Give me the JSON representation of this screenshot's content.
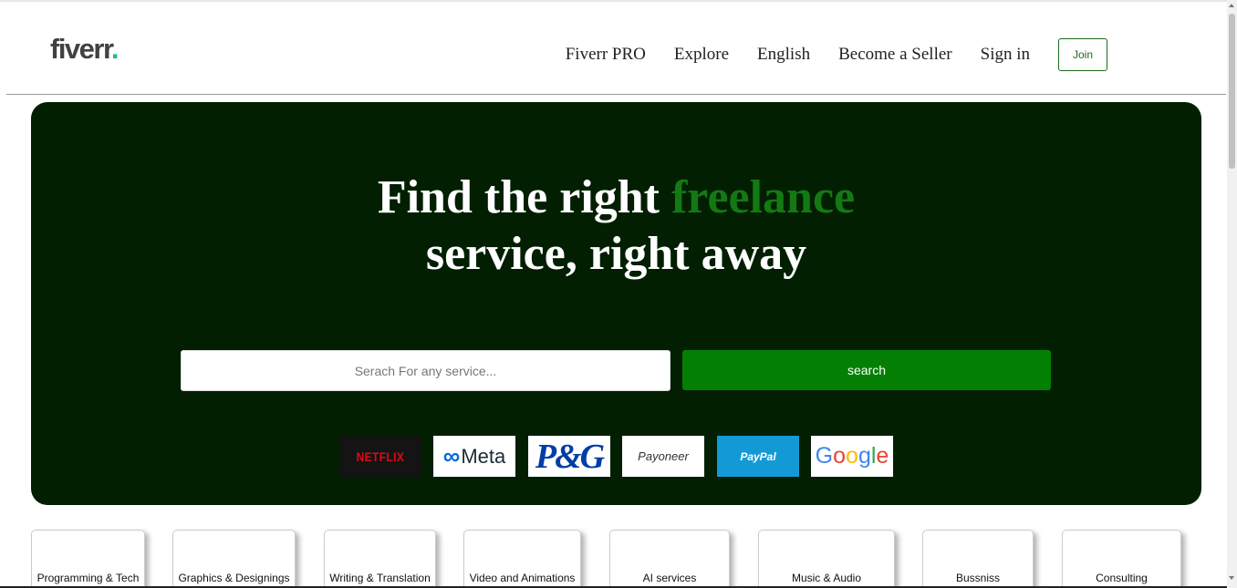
{
  "header": {
    "logo_text": "fiverr",
    "logo_dot": ".",
    "nav": [
      "Fiverr PRO",
      "Explore",
      "English",
      "Become a Seller",
      "Sign in"
    ],
    "join_label": "Join"
  },
  "hero": {
    "title_part1": "Find the right ",
    "title_accent": "freelance",
    "title_part2": "service, right away",
    "search_placeholder": "Serach For any service...",
    "search_button": "search",
    "brands": [
      "NETFLIX",
      "Meta",
      "P&G",
      "Payoneer",
      "PayPal",
      "Google"
    ]
  },
  "categories": [
    "Programming & Tech",
    "Graphics & Designings",
    "Writing & Translation",
    "Video and Animations",
    "AI services",
    "Music & Audio",
    "Bussniss",
    "Consulting"
  ],
  "colors": {
    "hero_bg": "#021f02",
    "accent": "#137a13",
    "button": "#038003",
    "logo_dot": "#1dbf73"
  }
}
